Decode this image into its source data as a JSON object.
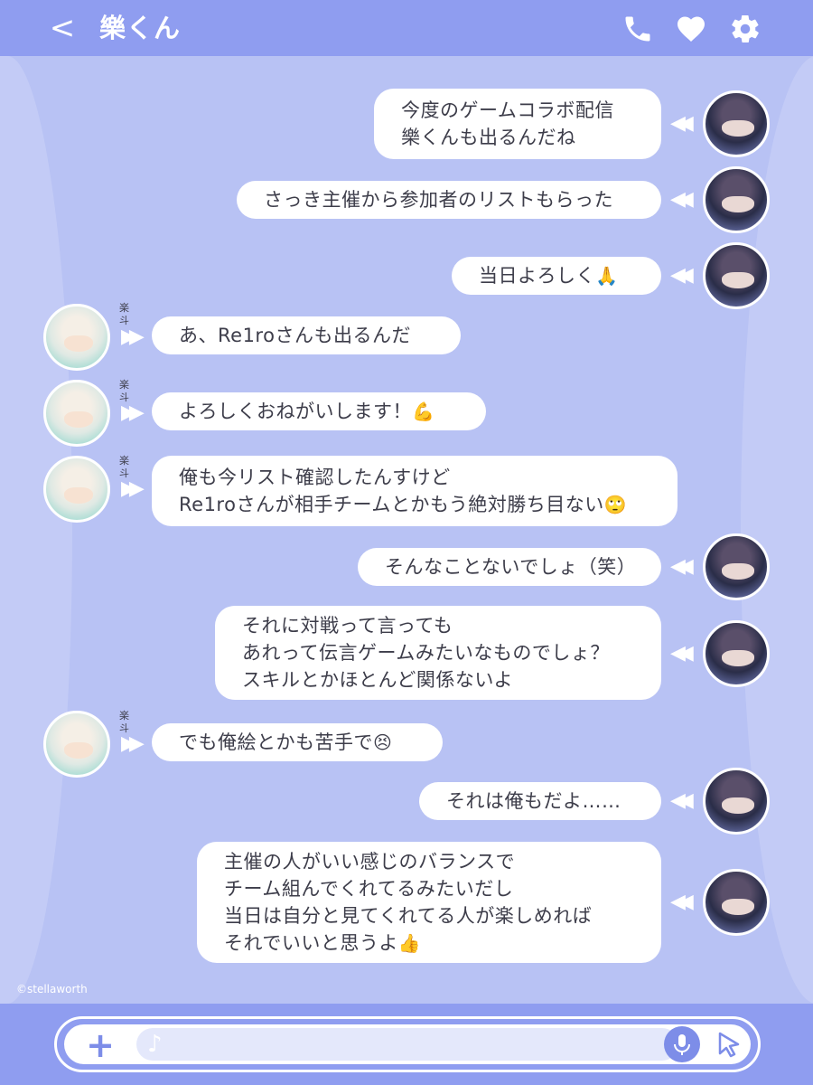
{
  "header": {
    "back_label": "<",
    "title": "樂くん"
  },
  "contact_name": "楽斗",
  "messages": [
    {
      "side": "right",
      "lines": [
        "今度のゲームコラボ配信",
        "樂くんも出るんだね"
      ],
      "emoji": ""
    },
    {
      "side": "right",
      "lines": [
        "さっき主催から参加者のリストもらった"
      ],
      "emoji": ""
    },
    {
      "side": "right",
      "lines": [
        "当日よろしく"
      ],
      "emoji": "🙏"
    },
    {
      "side": "left",
      "lines": [
        "あ、Re1roさんも出るんだ"
      ],
      "emoji": ""
    },
    {
      "side": "left",
      "lines": [
        "よろしくおねがいします！"
      ],
      "emoji": "💪"
    },
    {
      "side": "left",
      "lines": [
        "俺も今リスト確認したんすけど",
        "Re1roさんが相手チームとかもう絶対勝ち目ない"
      ],
      "emoji": "🙄"
    },
    {
      "side": "right",
      "lines": [
        "そんなことないでしょ（笑）"
      ],
      "emoji": ""
    },
    {
      "side": "right",
      "lines": [
        "それに対戦って言っても",
        "あれって伝言ゲームみたいなものでしょ？",
        "スキルとかほとんど関係ないよ"
      ],
      "emoji": ""
    },
    {
      "side": "left",
      "lines": [
        "でも俺絵とかも苦手で"
      ],
      "emoji": "😣"
    },
    {
      "side": "right",
      "lines": [
        "それは俺もだよ……"
      ],
      "emoji": ""
    },
    {
      "side": "right",
      "lines": [
        "主催の人がいい感じのバランスで",
        "チーム組んでくれてるみたいだし",
        "当日は自分と見てくれてる人が楽しめれば",
        "それでいいと思うよ"
      ],
      "emoji": "👍"
    }
  ],
  "copyright": "©stellaworth",
  "colors": {
    "header": "#8f9df0",
    "chat_bg": "#b8c2f4",
    "accent": "#7d8de8",
    "bubble": "#ffffff",
    "text": "#3d3d4a"
  },
  "icons": {
    "phone": "phone-icon",
    "heart": "heart-icon",
    "settings": "gear-icon",
    "plus": "plus-icon",
    "music_note": "music-note-icon",
    "mic": "microphone-icon",
    "send": "cursor-send-icon"
  }
}
